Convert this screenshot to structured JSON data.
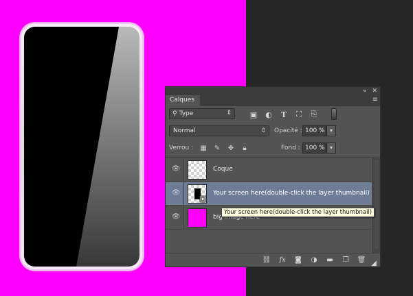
{
  "colors": {
    "canvas_bg": "#ff00ff",
    "selection": "#6f7c95"
  },
  "panel": {
    "collapse_icon": "«",
    "close_icon": "✕",
    "tab_label": "Calques",
    "menu_icon": "≡",
    "filter": {
      "value": "Type",
      "icons": [
        "image-filter-icon",
        "adjustment-filter-icon",
        "text-filter-icon",
        "shape-filter-icon",
        "smart-object-filter-icon"
      ]
    },
    "blend_mode": "Normal",
    "opacity_label": "Opacité :",
    "opacity_value": "100 %",
    "lock_label": "Verrou :",
    "fill_label": "Fond :",
    "fill_value": "100 %",
    "layers": [
      {
        "name": "Coque",
        "thumb": "transparent",
        "selected": false
      },
      {
        "name": "Your screen here(double-click the layer thumbnail)",
        "thumb": "smart-object",
        "selected": true
      },
      {
        "name": "big image here",
        "thumb": "magenta",
        "selected": false
      }
    ],
    "bottom_icons": [
      "link-icon",
      "fx-icon",
      "mask-icon",
      "adjustment-icon",
      "folder-icon",
      "new-layer-icon",
      "trash-icon"
    ]
  },
  "tooltip": "Your screen here(double-click the layer thumbnail)"
}
